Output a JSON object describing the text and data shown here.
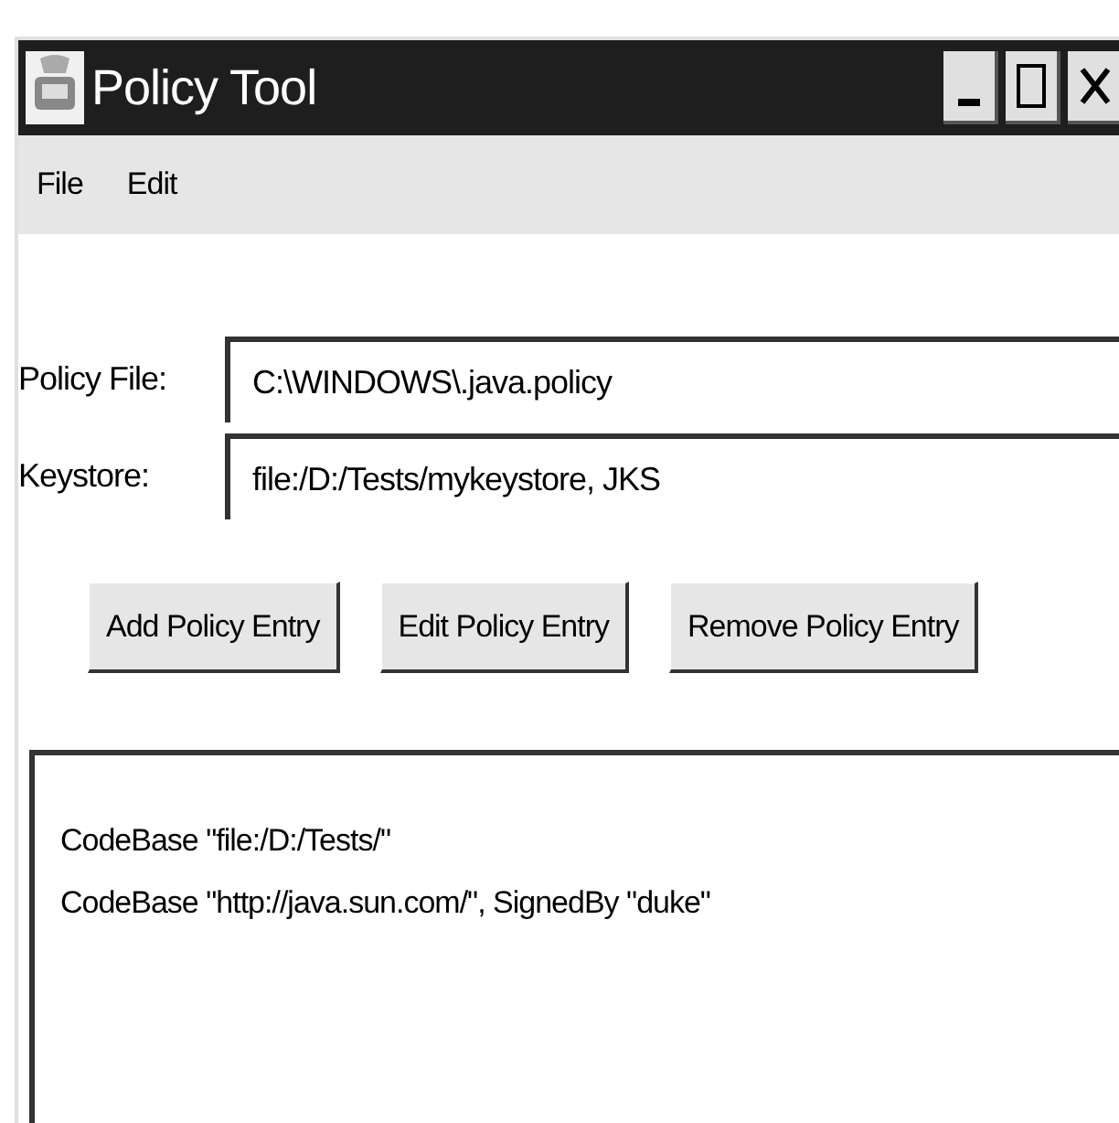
{
  "window": {
    "title": "Policy Tool"
  },
  "menu": [
    "File",
    "Edit"
  ],
  "fields": [
    {
      "label": "Policy File:",
      "value": "C:\\WINDOWS\\.java.policy"
    },
    {
      "label": "Keystore:",
      "value": "file:/D:/Tests/mykeystore, JKS"
    }
  ],
  "buttons": [
    "Add Policy Entry",
    "Edit Policy Entry",
    "Remove Policy Entry"
  ],
  "entries": [
    "CodeBase \"file:/D:/Tests/\"",
    "CodeBase \"http://java.sun.com/\", SignedBy \"duke\""
  ]
}
